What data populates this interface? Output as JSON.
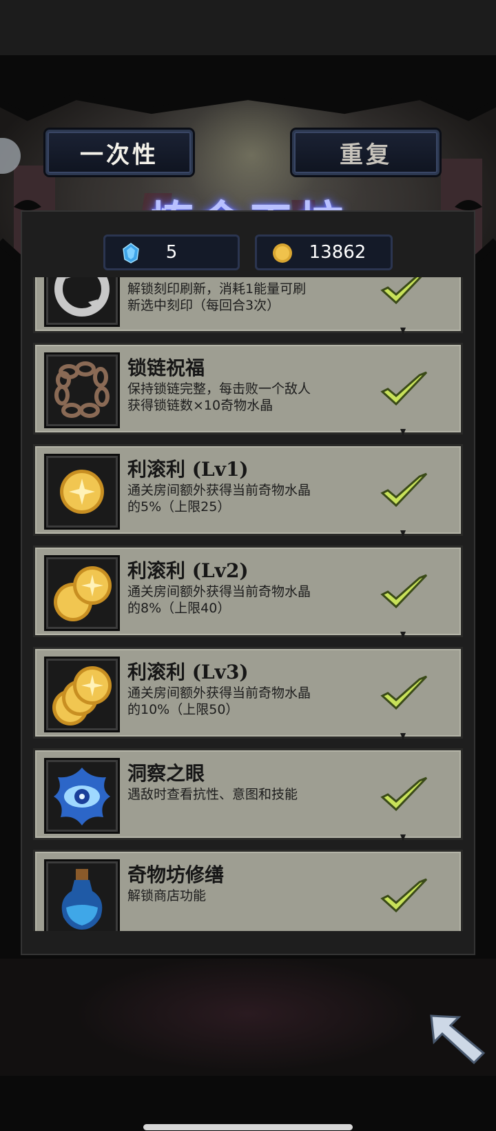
{
  "tabs": {
    "one_time": "一次性",
    "repeat": "重复"
  },
  "title": "炼金工坊",
  "resources": {
    "crystals": "5",
    "coins": "13862"
  },
  "items": [
    {
      "name": "",
      "desc": "解锁刻印刷新，消耗1能量可刷新选中刻印（每回合3次）",
      "icon": "refresh-icon"
    },
    {
      "name": "锁链祝福",
      "desc": "保持锁链完整，每击败一个敌人获得锁链数×10奇物水晶",
      "icon": "chain-icon"
    },
    {
      "name": "利滚利 (Lv1)",
      "desc": "通关房间额外获得当前奇物水晶的5%（上限25）",
      "icon": "coin-icon"
    },
    {
      "name": "利滚利 (Lv2)",
      "desc": "通关房间额外获得当前奇物水晶的8%（上限40）",
      "icon": "two-coins-icon"
    },
    {
      "name": "利滚利 (Lv3)",
      "desc": "通关房间额外获得当前奇物水晶的10%（上限50）",
      "icon": "three-coins-icon"
    },
    {
      "name": "洞察之眼",
      "desc": "遇敌时查看抗性、意图和技能",
      "icon": "eye-icon"
    },
    {
      "name": "奇物坊修缮",
      "desc": "解锁商店功能",
      "icon": "potion-icon"
    }
  ],
  "colors": {
    "accent_title": "#b8c0ff",
    "card_bg": "#9e9e92",
    "check": "#c8e25a"
  }
}
